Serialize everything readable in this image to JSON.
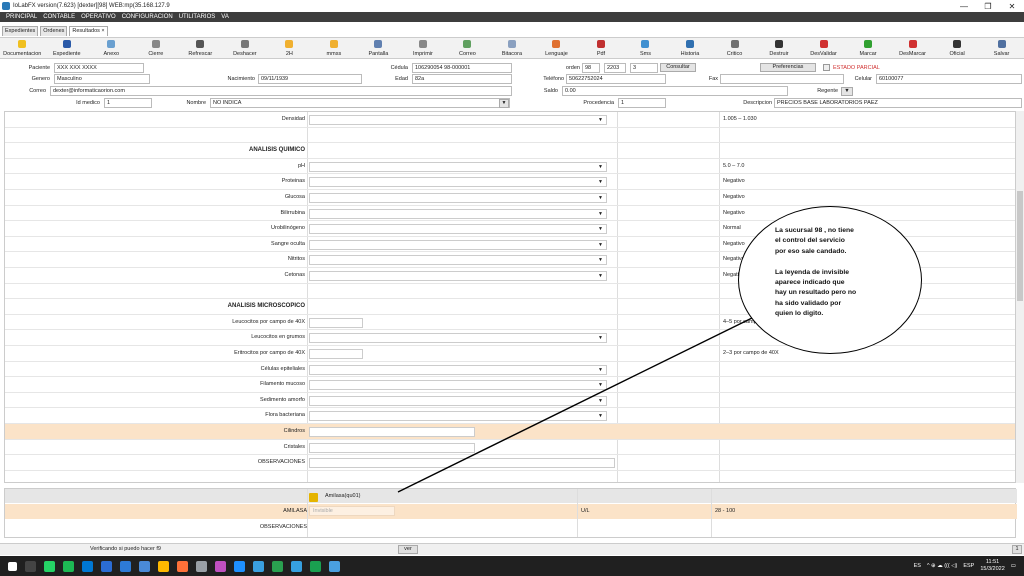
{
  "window": {
    "title": "IoLabFX version(7.623)  [dexter][98] WEB:mp(35.168.127.9",
    "controls": [
      "—",
      "❐",
      "✕"
    ]
  },
  "menu": [
    "PRINCIPAL",
    "CONTABLE",
    "OPERATIVO",
    "CONFIGURACION",
    "UTILITARIOS",
    "VA"
  ],
  "tabs": [
    "Expedientes",
    "Ordenes",
    "Resultados ×"
  ],
  "toolbar": [
    {
      "label": "Documentacion",
      "color": "#f0c020"
    },
    {
      "label": "Expediente",
      "color": "#2a5aa8"
    },
    {
      "label": "Anexo",
      "color": "#6aa0d0"
    },
    {
      "label": "Cierre",
      "color": "#888888"
    },
    {
      "label": "Refrescar",
      "color": "#555555"
    },
    {
      "label": "Deshacer",
      "color": "#777777"
    },
    {
      "label": "2H",
      "color": "#f0b030"
    },
    {
      "label": "mmss",
      "color": "#f0b030"
    },
    {
      "label": "Pantalla",
      "color": "#6080b0"
    },
    {
      "label": "Imprimir",
      "color": "#888888"
    },
    {
      "label": "Correo",
      "color": "#60a060"
    },
    {
      "label": "Bitacora",
      "color": "#8aa0c0"
    },
    {
      "label": "Lenguaje",
      "color": "#e07030"
    },
    {
      "label": "Pdf",
      "color": "#c03030"
    },
    {
      "label": "Sms",
      "color": "#4090d0"
    },
    {
      "label": "Historia",
      "color": "#3070b0"
    },
    {
      "label": "Critico",
      "color": "#707070"
    },
    {
      "label": "Destruir",
      "color": "#333333"
    },
    {
      "label": "DesValidar",
      "color": "#d03030"
    },
    {
      "label": "Marcar",
      "color": "#30a030"
    },
    {
      "label": "DesMarcar",
      "color": "#d03030"
    },
    {
      "label": "Oficial",
      "color": "#333333"
    },
    {
      "label": "Salvar",
      "color": "#5070a0"
    }
  ],
  "form": {
    "paciente_label": "Paciente",
    "paciente": "XXX XXX XXXX",
    "cedula_label": "Cédula",
    "cedula": "106290054  98-000001",
    "orden_label": "orden",
    "orden_suc": "98",
    "orden_num": "2203",
    "orden_ext": "3",
    "consultar": "Consultar",
    "preferencias": "Preferencias",
    "estado": "ESTADO PARCIAL",
    "genero_label": "Genero",
    "genero": "Masculino",
    "nacimiento_label": "Nacimiento",
    "nacimiento": "09/11/1939",
    "edad_label": "Edad",
    "edad": "82a",
    "telefono_label": "Teléfono",
    "telefono": "50622752024",
    "fax_label": "Fax",
    "celular_label": "Celular",
    "celular": "60100077",
    "correo_label": "Correo",
    "correo": "dexter@informaticaorion.com",
    "saldo_label": "Saldo",
    "saldo": "0.00",
    "regente_label": "Regente",
    "regente_btn": "▼",
    "idmedico_label": "Id medico",
    "idmedico": "1",
    "nombre_label": "Nombre",
    "nombre": "NO INDICA",
    "procedencia_label": "Procedencia",
    "procedencia": "1",
    "descripcion_label": "Descripcion",
    "descripcion": "PRECIOS BASE LABORATORIOS PAEZ"
  },
  "rows": [
    {
      "label": "Densidad",
      "input": "select",
      "ref": "1.005 – 1.030",
      "hdr": false,
      "hl": false
    },
    {
      "label": "",
      "input": "none",
      "ref": "",
      "hdr": false,
      "hl": false
    },
    {
      "label": "ANALISIS QUIMICO",
      "input": "none",
      "ref": "",
      "hdr": true,
      "hl": false
    },
    {
      "label": "pH",
      "input": "select",
      "ref": "5.0 – 7.0",
      "hdr": false,
      "hl": false
    },
    {
      "label": "Proteinas",
      "input": "select",
      "ref": "Negativo",
      "hdr": false,
      "hl": false
    },
    {
      "label": "Glucosa",
      "input": "select",
      "ref": "Negativo",
      "hdr": false,
      "hl": false
    },
    {
      "label": "Bilirrubina",
      "input": "select",
      "ref": "Negativo",
      "hdr": false,
      "hl": false
    },
    {
      "label": "Urobilinógeno",
      "input": "select",
      "ref": "Normal",
      "hdr": false,
      "hl": false
    },
    {
      "label": "Sangre oculta",
      "input": "select",
      "ref": "Negativo",
      "hdr": false,
      "hl": false
    },
    {
      "label": "Nitritos",
      "input": "select",
      "ref": "Negativo",
      "hdr": false,
      "hl": false
    },
    {
      "label": "Cetonas",
      "input": "select",
      "ref": "Negativo",
      "hdr": false,
      "hl": false
    },
    {
      "label": "",
      "input": "none",
      "ref": "",
      "hdr": false,
      "hl": false
    },
    {
      "label": "ANALISIS MICROSCOPICO",
      "input": "none",
      "ref": "",
      "hdr": true,
      "hl": false
    },
    {
      "label": "Leucocitos por campo de 40X",
      "input": "short",
      "ref": "4–5 por campo de 40X",
      "hdr": false,
      "hl": false
    },
    {
      "label": "Leucocitos en grumos",
      "input": "select",
      "ref": "",
      "hdr": false,
      "hl": false
    },
    {
      "label": "Eritrocitos por campo de 40X",
      "input": "short",
      "ref": "2–3 por campo de 40X",
      "hdr": false,
      "hl": false
    },
    {
      "label": "Células epiteliales",
      "input": "select",
      "ref": "",
      "hdr": false,
      "hl": false
    },
    {
      "label": "Filamento mucoso",
      "input": "select",
      "ref": "",
      "hdr": false,
      "hl": false
    },
    {
      "label": "Sedimento amorfo",
      "input": "select",
      "ref": "",
      "hdr": false,
      "hl": false
    },
    {
      "label": "Flora bacteriana",
      "input": "select",
      "ref": "",
      "hdr": false,
      "hl": false
    },
    {
      "label": "Cilindros",
      "input": "text",
      "ref": "",
      "hdr": false,
      "hl": true
    },
    {
      "label": "Cristales",
      "input": "text",
      "ref": "",
      "hdr": false,
      "hl": false
    },
    {
      "label": "OBSERVACIONES",
      "input": "wide",
      "ref": "",
      "hdr": false,
      "hl": false
    }
  ],
  "lower": {
    "test_header": "Amilasa(qu01)",
    "test_label": "AMILASA",
    "test_value": "Invisible",
    "unit": "U/L",
    "ref": "28 - 100",
    "obs_label": "OBSERVACIONES"
  },
  "annotation": {
    "lines": [
      "La sucursal 98 , no tiene",
      "el control del servicio",
      "por eso sale candado.",
      "",
      "La leyenda de invisible",
      "aparece indicado que",
      "hay un resultado pero no",
      "ha sido validado por",
      "quien lo digito."
    ]
  },
  "status": {
    "text": "Verificando si puedo hacer f9",
    "button": "ver",
    "right": "1"
  },
  "taskbar": {
    "icons": [
      "#ffffff",
      "#444444",
      "#25d366",
      "#1db954",
      "#0078d4",
      "#2b6cd4",
      "#2d7ad6",
      "#4a8ad8",
      "#ffb900",
      "#ff7139",
      "#9aa0a6",
      "#c050c0",
      "#1e90ff",
      "#3aa0e0",
      "#2aa050",
      "#36a0e0",
      "#1aa050",
      "#4aa0e0"
    ],
    "lang_left": "ES",
    "lang": "ESP",
    "time": "11:51",
    "date": "15/3/2022",
    "tray": "^ ⊕ ☁ ((( ◁)"
  }
}
